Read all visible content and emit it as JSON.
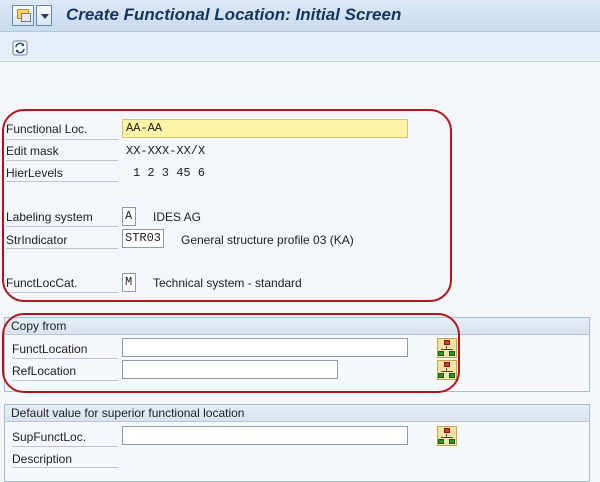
{
  "window": {
    "title": "Create Functional Location: Initial Screen"
  },
  "toolbar": {
    "icons": [
      "customize-menu-icon",
      "dropdown-icon",
      "refresh-icon"
    ]
  },
  "form": {
    "functional_loc": {
      "label": "Functional Loc.",
      "value": "AA-AA"
    },
    "edit_mask": {
      "label": "Edit mask",
      "value": "XX-XXX-XX/X"
    },
    "hier_levels": {
      "label": "HierLevels",
      "value": "1 2 3 45 6"
    },
    "labeling_system": {
      "label": "Labeling system",
      "value": "A",
      "description": "IDES AG"
    },
    "str_indicator": {
      "label": "StrIndicator",
      "value": "STR03",
      "description": "General structure profile 03 (KA)"
    },
    "funct_loc_cat": {
      "label": "FunctLocCat.",
      "value": "M",
      "description": "Technical system - standard"
    }
  },
  "copy_from": {
    "title": "Copy from",
    "funct_location": {
      "label": "FunctLocation",
      "value": ""
    },
    "ref_location": {
      "label": "RefLocation",
      "value": ""
    }
  },
  "superior": {
    "title": "Default value for superior functional location",
    "sup_funct_loc": {
      "label": "SupFunctLoc.",
      "value": ""
    },
    "description": {
      "label": "Description",
      "value": ""
    }
  },
  "colors": {
    "annotation": "#b3151b",
    "required_field": "#fff3a8",
    "title_text": "#17355c"
  }
}
